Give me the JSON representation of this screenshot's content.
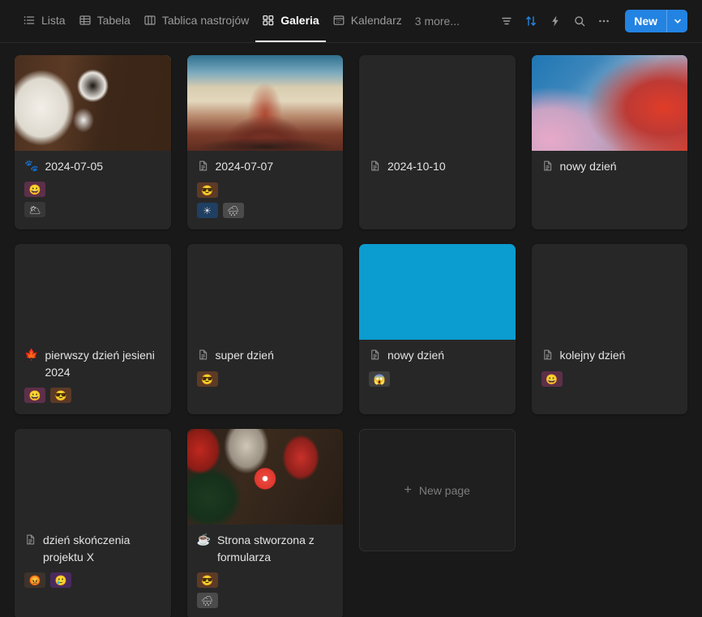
{
  "toolbar": {
    "views": [
      {
        "label": "Lista",
        "icon": "list-icon",
        "active": false
      },
      {
        "label": "Tabela",
        "icon": "table-icon",
        "active": false
      },
      {
        "label": "Tablica nastrojów",
        "icon": "board-icon",
        "active": false
      },
      {
        "label": "Galeria",
        "icon": "gallery-icon",
        "active": true
      },
      {
        "label": "Kalendarz",
        "icon": "calendar-icon",
        "active": false
      }
    ],
    "more_views_label": "3 more...",
    "actions": [
      {
        "name": "filter-icon",
        "label": "Filter",
        "accent": false
      },
      {
        "name": "sort-icon",
        "label": "Sort",
        "accent": true
      },
      {
        "name": "automation-icon",
        "label": "Automations",
        "accent": false
      },
      {
        "name": "search-icon",
        "label": "Search",
        "accent": false
      },
      {
        "name": "more-options-icon",
        "label": "More options",
        "accent": false
      }
    ],
    "new_button_label": "New",
    "accent_color": "#2383e2"
  },
  "gallery": {
    "cards": [
      {
        "title": "2024-07-05",
        "icon": "paw-prints-emoji",
        "icon_glyph": "🐾",
        "cover": "cover-desk",
        "tag_rows": [
          [
            {
              "emoji": "😀",
              "name": "tag-grinning-face",
              "bg": "#5d2f49"
            }
          ],
          [
            {
              "emoji": "🌥",
              "name": "tag-sun-behind-cloud",
              "bg": "#373737"
            }
          ]
        ]
      },
      {
        "title": "2024-07-07",
        "icon": "document-icon",
        "icon_glyph": "",
        "cover": "cover-fuji",
        "tag_rows": [
          [
            {
              "emoji": "😎",
              "name": "tag-sunglasses-face",
              "bg": "#5c3a26"
            }
          ],
          [
            {
              "emoji": "☀",
              "name": "tag-sun",
              "bg": "#1f3f63"
            },
            {
              "emoji": "🌧",
              "name": "tag-rain-cloud",
              "bg": "#4b4b4b"
            }
          ]
        ]
      },
      {
        "title": "2024-10-10",
        "icon": "document-icon",
        "icon_glyph": "",
        "cover": "",
        "tag_rows": []
      },
      {
        "title": "nowy dzień",
        "icon": "document-icon",
        "icon_glyph": "",
        "cover": "cover-gradient",
        "tag_rows": []
      },
      {
        "title": "pierwszy dzień jesieni 2024",
        "icon": "maple-leaf-emoji",
        "icon_glyph": "🍁",
        "cover": "",
        "tag_rows": [
          [
            {
              "emoji": "😀",
              "name": "tag-grinning-face",
              "bg": "#5d2f49"
            },
            {
              "emoji": "😎",
              "name": "tag-sunglasses-face",
              "bg": "#5c3a26"
            }
          ]
        ]
      },
      {
        "title": "super dzień",
        "icon": "document-icon",
        "icon_glyph": "",
        "cover": "",
        "tag_rows": [
          [
            {
              "emoji": "😎",
              "name": "tag-sunglasses-face",
              "bg": "#5c3a26"
            }
          ]
        ]
      },
      {
        "title": "nowy dzień",
        "icon": "document-icon",
        "icon_glyph": "",
        "cover": "cover-solid-cyan",
        "tag_rows": [
          [
            {
              "emoji": "😱",
              "name": "tag-screaming-face",
              "bg": "#3f3f3f"
            }
          ]
        ]
      },
      {
        "title": "kolejny dzień",
        "icon": "document-icon",
        "icon_glyph": "",
        "cover": "",
        "tag_rows": [
          [
            {
              "emoji": "😀",
              "name": "tag-grinning-face",
              "bg": "#5d2f49"
            }
          ]
        ]
      },
      {
        "title": "dzień skończenia projektu X",
        "icon": "document-icon",
        "icon_glyph": "",
        "cover": "",
        "tag_rows": [
          [
            {
              "emoji": "😡",
              "name": "tag-angry-face",
              "bg": "#3d332c"
            },
            {
              "emoji": "🥲",
              "name": "tag-sad-face",
              "bg": "#4a2a5e"
            }
          ]
        ]
      },
      {
        "title": "Strona stworzona z formularza",
        "icon": "coffee-emoji",
        "icon_glyph": "☕",
        "cover": "cover-xmas",
        "tag_rows": [
          [
            {
              "emoji": "😎",
              "name": "tag-sunglasses-face",
              "bg": "#5c3a26"
            }
          ],
          [
            {
              "emoji": "🌧",
              "name": "tag-rain-cloud",
              "bg": "#4b4b4b"
            }
          ]
        ]
      }
    ],
    "new_page_label": "New page",
    "new_page_plus": "+"
  }
}
